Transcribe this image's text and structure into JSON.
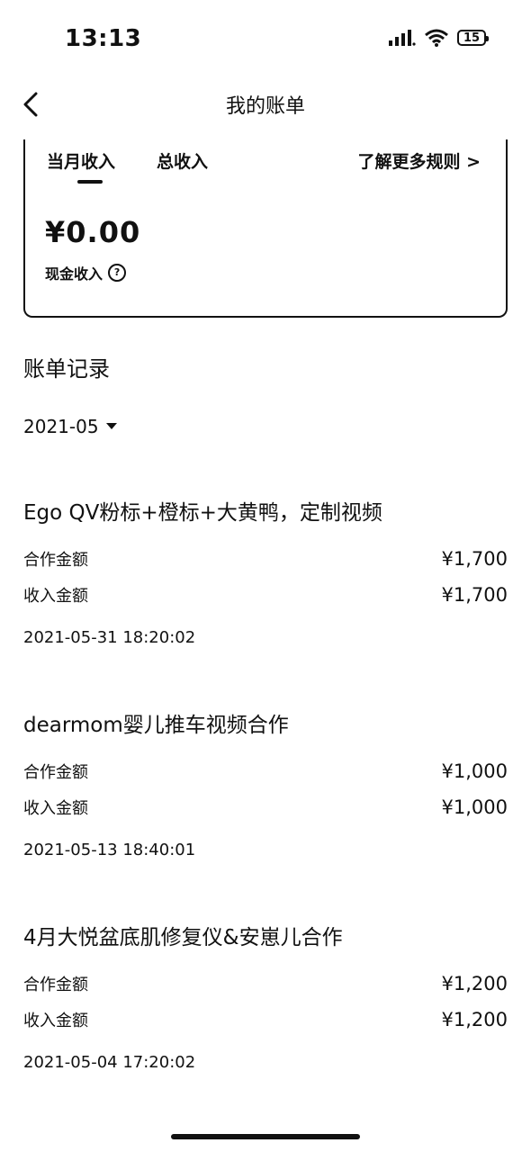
{
  "status": {
    "time": "13:13",
    "battery": "15"
  },
  "nav": {
    "title": "我的账单"
  },
  "income_card": {
    "tab_month": "当月收入",
    "tab_total": "总收入",
    "rules_link": "了解更多规则 >",
    "amount": "¥0.00",
    "cash_label": "现金收入",
    "help_symbol": "?"
  },
  "bill_section": {
    "title": "账单记录",
    "month": "2021-05"
  },
  "records": [
    {
      "title": "Ego QV粉标+橙标+大黄鸭，定制视频",
      "coop_label": "合作金额",
      "coop_amount": "¥1,700",
      "income_label": "收入金额",
      "income_amount": "¥1,700",
      "time": "2021-05-31 18:20:02"
    },
    {
      "title": "dearmom婴儿推车视频合作",
      "coop_label": "合作金额",
      "coop_amount": "¥1,000",
      "income_label": "收入金额",
      "income_amount": "¥1,000",
      "time": "2021-05-13 18:40:01"
    },
    {
      "title": "4月大悦盆底肌修复仪&安崽儿合作",
      "coop_label": "合作金额",
      "coop_amount": "¥1,200",
      "income_label": "收入金额",
      "income_amount": "¥1,200",
      "time": "2021-05-04 17:20:02"
    }
  ]
}
